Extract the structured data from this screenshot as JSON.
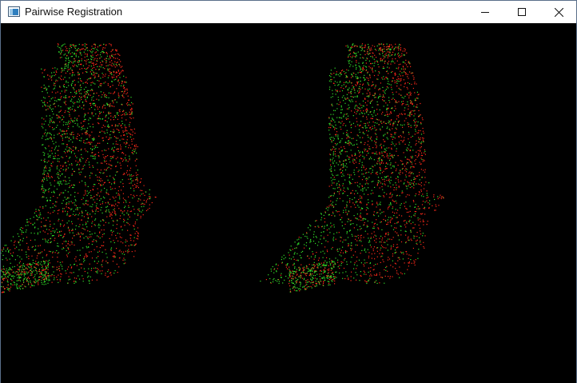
{
  "window": {
    "title": "Pairwise Registration",
    "app_icon": "vtk-window-icon",
    "controls": {
      "minimize_icon": "minimize-icon",
      "maximize_icon": "maximize-icon",
      "close_icon": "close-icon"
    }
  },
  "viewport": {
    "background": "#000000",
    "source_cloud_color": "#ff2a1a",
    "target_cloud_color": "#33e02a",
    "views": [
      {
        "name": "left-view"
      },
      {
        "name": "right-view"
      }
    ]
  }
}
